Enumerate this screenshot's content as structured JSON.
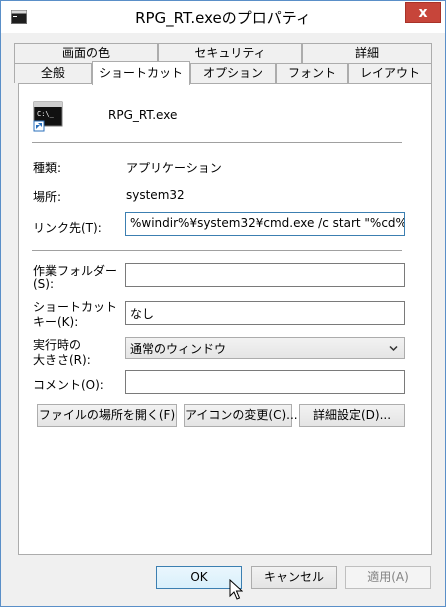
{
  "window": {
    "title": "RPG_RT.exeのプロパティ",
    "close_glyph": "x"
  },
  "tabs_top": [
    "画面の色",
    "セキュリティ",
    "詳細"
  ],
  "tabs_bottom": [
    "全般",
    "ショートカット",
    "オプション",
    "フォント",
    "レイアウト"
  ],
  "active_tab": "ショートカット",
  "shortcut": {
    "filename": "RPG_RT.exe",
    "type_label": "種類:",
    "type_value": "アプリケーション",
    "location_label": "場所:",
    "location_value": "system32",
    "target_label": "リンク先(T):",
    "target_value": "%windir%¥system32¥cmd.exe /c start \"%cd%",
    "workdir_label_1": "作業フォルダー",
    "workdir_label_2": "(S):",
    "workdir_value": "",
    "hotkey_label_1": "ショートカット",
    "hotkey_label_2": "キー(K):",
    "hotkey_value": "なし",
    "run_label_1": "実行時の",
    "run_label_2": "大きさ(R):",
    "run_value": "通常のウィンドウ",
    "comment_label": "コメント(O):",
    "comment_value": "",
    "open_location_button": "ファイルの場所を開く(F)",
    "change_icon_button": "アイコンの変更(C)...",
    "advanced_button": "詳細設定(D)..."
  },
  "dialog_buttons": {
    "ok": "OK",
    "cancel": "キャンセル",
    "apply": "適用(A)"
  },
  "colors": {
    "window_border": "#5a8fc8",
    "close_button": "#c7453a",
    "focus_border": "#3c7fb1"
  }
}
